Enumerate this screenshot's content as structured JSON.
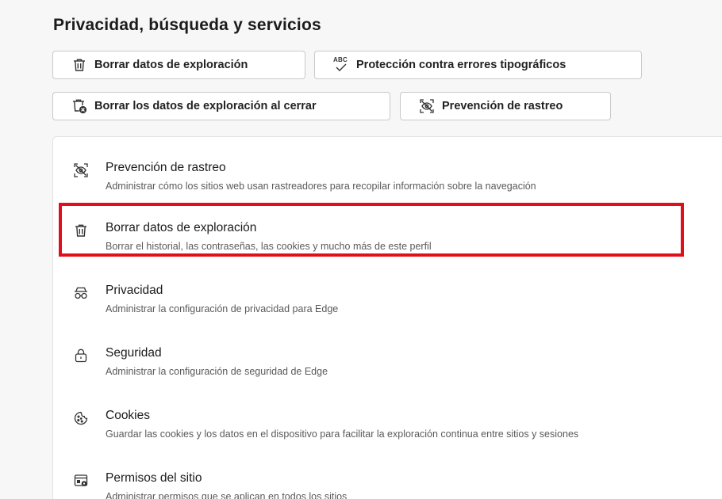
{
  "page": {
    "title": "Privacidad, búsqueda y servicios"
  },
  "quick_actions": [
    {
      "label": "Borrar datos de exploración",
      "icon": "trash-icon"
    },
    {
      "label": "Protección contra errores tipográficos",
      "icon": "spellcheck-icon",
      "icon_text": "ABC"
    },
    {
      "label": "Borrar los datos de exploración al cerrar",
      "icon": "trash-close-icon"
    },
    {
      "label": "Prevención de rastreo",
      "icon": "tracking-prevention-icon"
    }
  ],
  "settings": [
    {
      "title": "Prevención de rastreo",
      "description": "Administrar cómo los sitios web usan rastreadores para recopilar información sobre la navegación",
      "icon": "tracking-prevention-icon"
    },
    {
      "title": "Borrar datos de exploración",
      "description": "Borrar el historial, las contraseñas, las cookies y mucho más de este perfil",
      "icon": "trash-icon"
    },
    {
      "title": "Privacidad",
      "description": "Administrar la configuración de privacidad para Edge",
      "icon": "incognito-glasses-icon"
    },
    {
      "title": "Seguridad",
      "description": "Administrar la configuración de seguridad de Edge",
      "icon": "lock-icon"
    },
    {
      "title": "Cookies",
      "description": "Guardar las cookies y los datos en el dispositivo para facilitar la exploración continua entre sitios y sesiones",
      "icon": "cookie-icon"
    },
    {
      "title": "Permisos del sitio",
      "description": "Administrar permisos que se aplican en todos los sitios",
      "icon": "site-permissions-icon"
    }
  ],
  "highlight": {
    "target": "Borrar datos de exploración",
    "color": "#e0101a"
  },
  "colors": {
    "background": "#f7f7f7",
    "card": "#ffffff",
    "chip_border": "#c9c9c9",
    "highlight": "#e0101a"
  }
}
